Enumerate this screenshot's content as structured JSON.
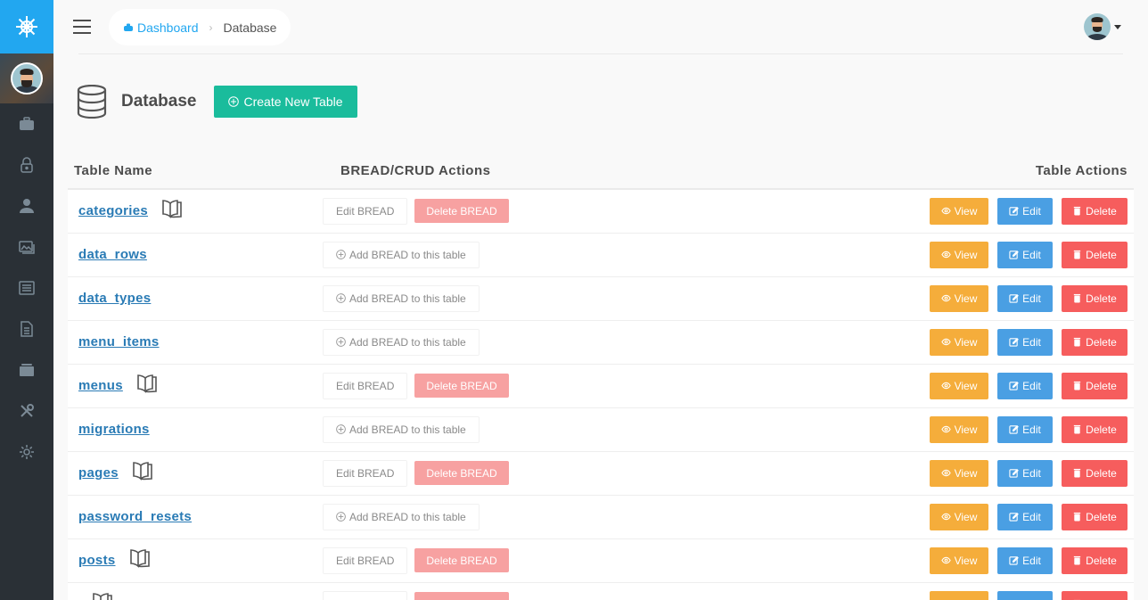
{
  "breadcrumb": {
    "home_label": "Dashboard",
    "current_label": "Database"
  },
  "page": {
    "title": "Database",
    "create_button_label": "Create New Table"
  },
  "table": {
    "headers": {
      "name": "Table Name",
      "bread": "BREAD/CRUD Actions",
      "actions": "Table Actions"
    },
    "labels": {
      "edit_bread": "Edit BREAD",
      "delete_bread": "Delete BREAD",
      "add_bread": "Add BREAD to this table",
      "view": "View",
      "edit": "Edit",
      "delete": "Delete"
    },
    "rows": [
      {
        "name": "categories",
        "has_bread": true
      },
      {
        "name": "data_rows",
        "has_bread": false
      },
      {
        "name": "data_types",
        "has_bread": false
      },
      {
        "name": "menu_items",
        "has_bread": false
      },
      {
        "name": "menus",
        "has_bread": true
      },
      {
        "name": "migrations",
        "has_bread": false
      },
      {
        "name": "pages",
        "has_bread": true
      },
      {
        "name": "password_resets",
        "has_bread": false
      },
      {
        "name": "posts",
        "has_bread": true
      },
      {
        "name": "",
        "has_bread": true
      }
    ]
  },
  "colors": {
    "brand": "#22a7f0",
    "sidebar": "#2a3036",
    "create": "#1abc9c",
    "view": "#f5ad3b",
    "edit": "#4a9fe3",
    "delete": "#f65d5d",
    "delete_bread": "#f7a1a1",
    "link": "#2a7bb5"
  },
  "sidebar": {
    "items": [
      {
        "icon": "briefcase-icon"
      },
      {
        "icon": "lock-icon"
      },
      {
        "icon": "user-icon"
      },
      {
        "icon": "images-icon"
      },
      {
        "icon": "news-icon"
      },
      {
        "icon": "document-icon"
      },
      {
        "icon": "folder-icon"
      },
      {
        "icon": "tools-icon"
      },
      {
        "icon": "settings-icon"
      }
    ]
  }
}
